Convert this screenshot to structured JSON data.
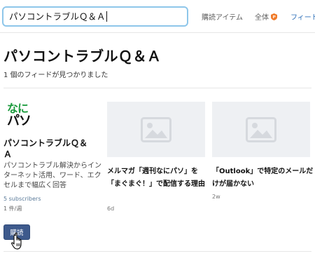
{
  "search": {
    "value": "パソコントラブルＱ＆Ａ"
  },
  "tabs": {
    "items": "購読アイテム",
    "all": "全体",
    "feeds": "フィード"
  },
  "page": {
    "title": "パソコントラブルＱ＆Ａ",
    "result_count": "1 個のフィードが見つかりました"
  },
  "feed": {
    "logo_line1": "なに",
    "logo_line2": "パソ",
    "name": "パソコントラブルＱ＆Ａ",
    "description": "パソコントラブル解決からインターネット活用、ワード、エクセルまで幅広く回答",
    "subscribers": "5 subscribers",
    "frequency": "1 件/週",
    "subscribe_label": "購読"
  },
  "cards": [
    {
      "title": "メルマガ「週刊なにパソ」を「まぐまぐ！」で配信する理由",
      "time": "6d",
      "thumb_icon": "image-placeholder-icon"
    },
    {
      "title": "「Outlook」で特定のメールだけが届かない",
      "time": "2w",
      "thumb_icon": "image-placeholder-icon"
    }
  ],
  "colors": {
    "accent": "#2d6fb8",
    "search_border": "#8ec6ea",
    "button": "#3e5a8c",
    "logo_green": "#1a9a3c",
    "pro_badge": "#f07b2a"
  }
}
